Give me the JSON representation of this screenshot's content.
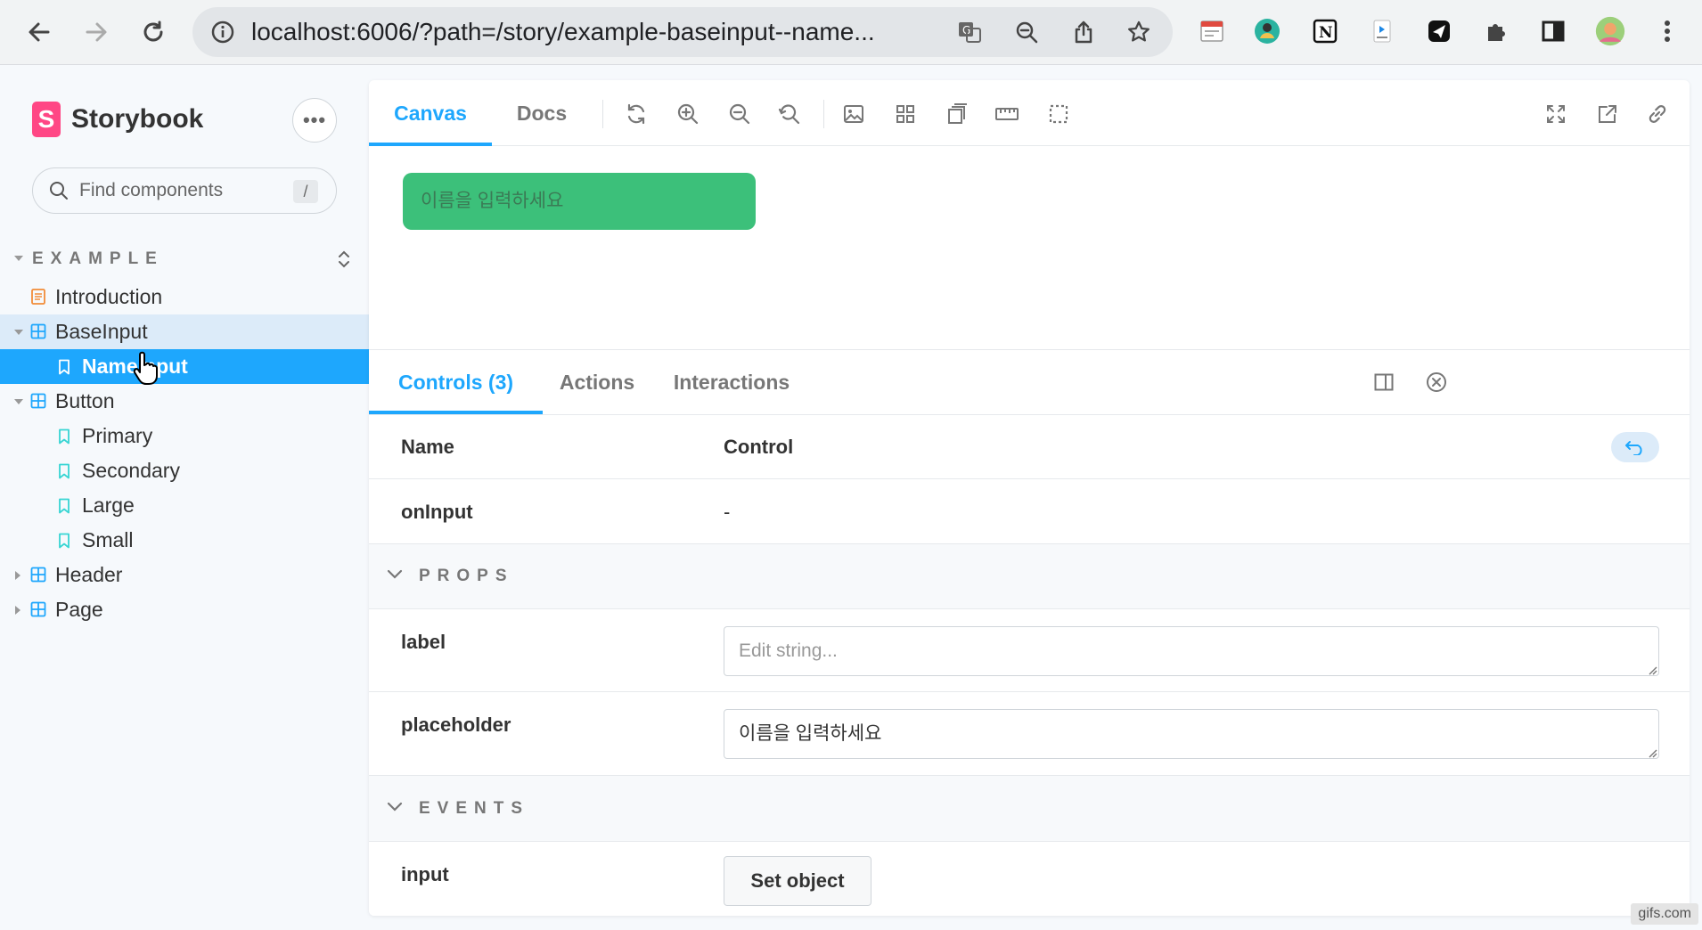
{
  "browser": {
    "url": "localhost:6006/?path=/story/example-baseinput--name..."
  },
  "sidebar": {
    "brand": "Storybook",
    "brand_letter": "S",
    "more_label": "•••",
    "search_placeholder": "Find components",
    "search_shortcut": "/",
    "section_title": "EXAMPLE",
    "items": [
      {
        "label": "Introduction"
      },
      {
        "label": "BaseInput"
      },
      {
        "label": "NameInput"
      },
      {
        "label": "Button"
      },
      {
        "label": "Primary"
      },
      {
        "label": "Secondary"
      },
      {
        "label": "Large"
      },
      {
        "label": "Small"
      },
      {
        "label": "Header"
      },
      {
        "label": "Page"
      }
    ]
  },
  "toolbar": {
    "tabs": [
      "Canvas",
      "Docs"
    ]
  },
  "canvas": {
    "input_placeholder": "이름을 입력하세요"
  },
  "addons": {
    "tabs": [
      "Controls (3)",
      "Actions",
      "Interactions"
    ],
    "header": {
      "name": "Name",
      "control": "Control"
    },
    "rows": {
      "oninput_name": "onInput",
      "oninput_value": "-",
      "props_section": "PROPS",
      "label_name": "label",
      "label_placeholder": "Edit string...",
      "placeholder_name": "placeholder",
      "placeholder_value": "이름을 입력하세요",
      "events_section": "EVENTS",
      "input_name": "input",
      "input_button": "Set object"
    }
  },
  "watermark": "gifs.com",
  "colors": {
    "accent": "#1ea7fd",
    "brand": "#ff4785",
    "preview_input": "#3cc07a"
  }
}
